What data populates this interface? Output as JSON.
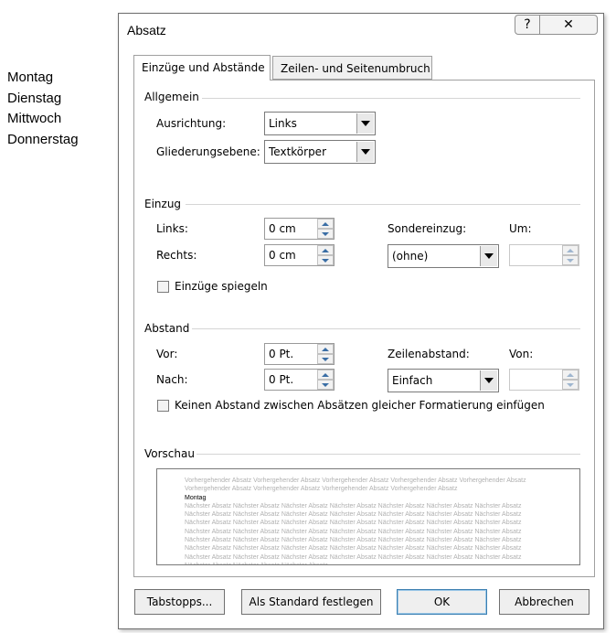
{
  "document": {
    "lines": [
      "Montag",
      "Dienstag",
      "Mittwoch",
      "Donnerstag"
    ]
  },
  "dialog": {
    "title": "Absatz",
    "help_glyph": "?",
    "close_glyph": "✕",
    "tabs": [
      {
        "label": "Einzüge und Abstände",
        "active": true
      },
      {
        "label": "Zeilen- und Seitenumbruch",
        "active": false
      }
    ],
    "allgemein": {
      "heading": "Allgemein",
      "ausrichtung_label": "Ausrichtung:",
      "ausrichtung_value": "Links",
      "gliederung_label": "Gliederungsebene:",
      "gliederung_value": "Textkörper"
    },
    "einzug": {
      "heading": "Einzug",
      "links_label": "Links:",
      "links_value": "0 cm",
      "rechts_label": "Rechts:",
      "rechts_value": "0 cm",
      "sondereinzug_label": "Sondereinzug:",
      "sondereinzug_value": "(ohne)",
      "um_label": "Um:",
      "um_value": "",
      "spiegeln_label": "Einzüge spiegeln"
    },
    "abstand": {
      "heading": "Abstand",
      "vor_label": "Vor:",
      "vor_value": "0 Pt.",
      "nach_label": "Nach:",
      "nach_value": "0 Pt.",
      "zeilenabstand_label": "Zeilenabstand:",
      "zeilenabstand_value": "Einfach",
      "von_label": "Von:",
      "von_value": "",
      "keinen_label": "Keinen Abstand zwischen Absätzen gleicher Formatierung einfügen"
    },
    "vorschau": {
      "heading": "Vorschau",
      "prev_text": "Vorhergehender Absatz Vorhergehender Absatz Vorhergehender Absatz Vorhergehender Absatz Vorhergehender Absatz Vorhergehender Absatz Vorhergehender Absatz Vorhergehender Absatz Vorhergehender Absatz",
      "current_text": "Montag",
      "next_text": "Nächster Absatz Nächster Absatz Nächster Absatz Nächster Absatz Nächster Absatz Nächster Absatz Nächster Absatz Nächster Absatz Nächster Absatz Nächster Absatz Nächster Absatz Nächster Absatz Nächster Absatz Nächster Absatz Nächster Absatz Nächster Absatz Nächster Absatz Nächster Absatz Nächster Absatz Nächster Absatz Nächster Absatz Nächster Absatz Nächster Absatz Nächster Absatz Nächster Absatz Nächster Absatz Nächster Absatz Nächster Absatz Nächster Absatz Nächster Absatz Nächster Absatz Nächster Absatz Nächster Absatz Nächster Absatz Nächster Absatz Nächster Absatz Nächster Absatz Nächster Absatz Nächster Absatz Nächster Absatz Nächster Absatz Nächster Absatz Nächster Absatz Nächster Absatz Nächster Absatz Nächster Absatz Nächster Absatz Nächster Absatz Nächster Absatz Nächster Absatz Nächster Absatz Nächster Absatz"
    },
    "buttons": {
      "tabstopps": "Tabstopps...",
      "standard": "Als Standard festlegen",
      "ok": "OK",
      "abbrechen": "Abbrechen"
    }
  }
}
